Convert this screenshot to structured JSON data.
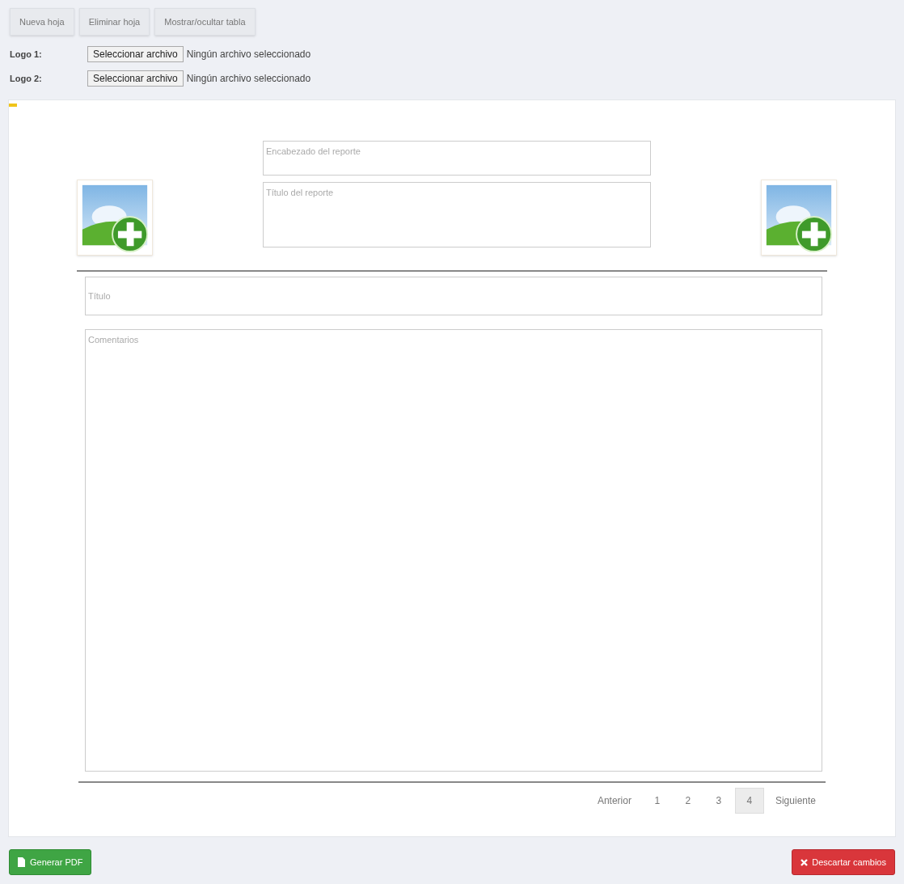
{
  "toolbar": {
    "buttons": [
      "Nueva hoja",
      "Eliminar hoja",
      "Mostrar/ocultar tabla"
    ]
  },
  "logo_inputs": [
    {
      "label": "Logo 1:",
      "button": "Seleccionar archivo",
      "status": "Ningún archivo seleccionado"
    },
    {
      "label": "Logo 2:",
      "button": "Seleccionar archivo",
      "status": "Ningún archivo seleccionado"
    }
  ],
  "report": {
    "header_placeholder": "Encabezado del reporte",
    "title_placeholder": "Título del reporte",
    "section_title_placeholder": "Título",
    "comments_placeholder": "Comentarios"
  },
  "pagination": {
    "previous": "Anterior",
    "next": "Siguiente",
    "pages": [
      {
        "label": "1",
        "selected": false
      },
      {
        "label": "2",
        "selected": false
      },
      {
        "label": "3",
        "selected": false
      },
      {
        "label": "4",
        "selected": true
      }
    ]
  },
  "footer": {
    "generate": "Generar PDF",
    "discard": "Descartar cambios"
  }
}
